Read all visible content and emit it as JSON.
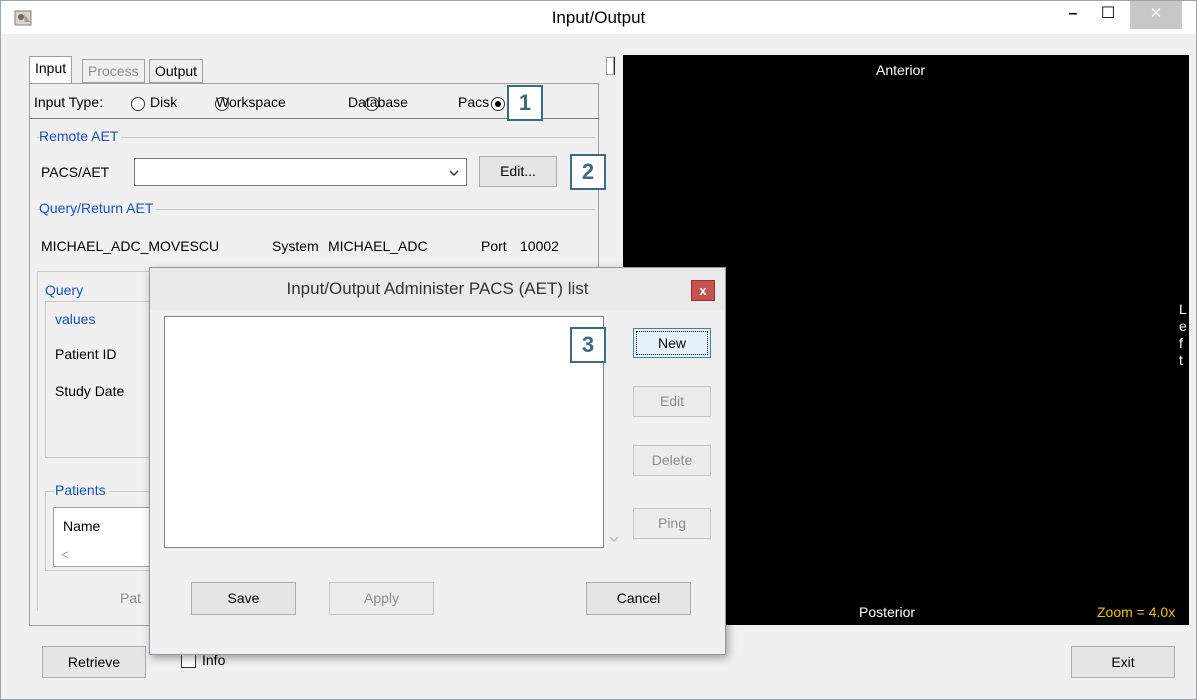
{
  "window": {
    "title": "Input/Output",
    "controls": {
      "minimize": "–",
      "maximize": "☐",
      "close": "✕"
    }
  },
  "tabs": [
    "Input",
    "Process",
    "Output"
  ],
  "input_type": {
    "label": "Input Type:",
    "options": [
      "Disk",
      "Workspace",
      "Database",
      "Pacs"
    ],
    "selected": "Pacs"
  },
  "remote_aet": {
    "group_label": "Remote AET",
    "field_label": "PACS/AET",
    "value": "",
    "edit_button": "Edit..."
  },
  "query_return_aet": {
    "group_label": "Query/Return AET",
    "aet": "MICHAEL_ADC_MOVESCU",
    "system_label": "System",
    "system": "MICHAEL_ADC",
    "port_label": "Port",
    "port": "10002"
  },
  "query": {
    "group_label": "Query",
    "values_label": "values",
    "patient_id_label": "Patient ID",
    "study_date_label": "Study Date"
  },
  "patients": {
    "group_label": "Patients",
    "columns": [
      "Name"
    ],
    "scroll_left": "<",
    "radio_label": "Pat"
  },
  "bottom": {
    "retrieve_button": "Retrieve",
    "info_label": "Info",
    "exit_button": "Exit"
  },
  "viewer": {
    "top_label": "Anterior",
    "bottom_label": "Posterior",
    "right_label": [
      "L",
      "e",
      "f",
      "t"
    ],
    "zoom": "Zoom = 4.0x",
    "zoom_color": "#f2c200"
  },
  "dialog": {
    "title": "Input/Output Administer PACS (AET) list",
    "close": "x",
    "buttons": {
      "new": "New",
      "edit": "Edit",
      "delete": "Delete",
      "ping": "Ping"
    },
    "footer": {
      "save": "Save",
      "apply": "Apply",
      "cancel": "Cancel"
    }
  },
  "markers": [
    "1",
    "2",
    "3"
  ],
  "colors": {
    "marker_border": "#3d6b86",
    "group_label": "#1a4fbf",
    "dialog_close": "#c75050"
  }
}
